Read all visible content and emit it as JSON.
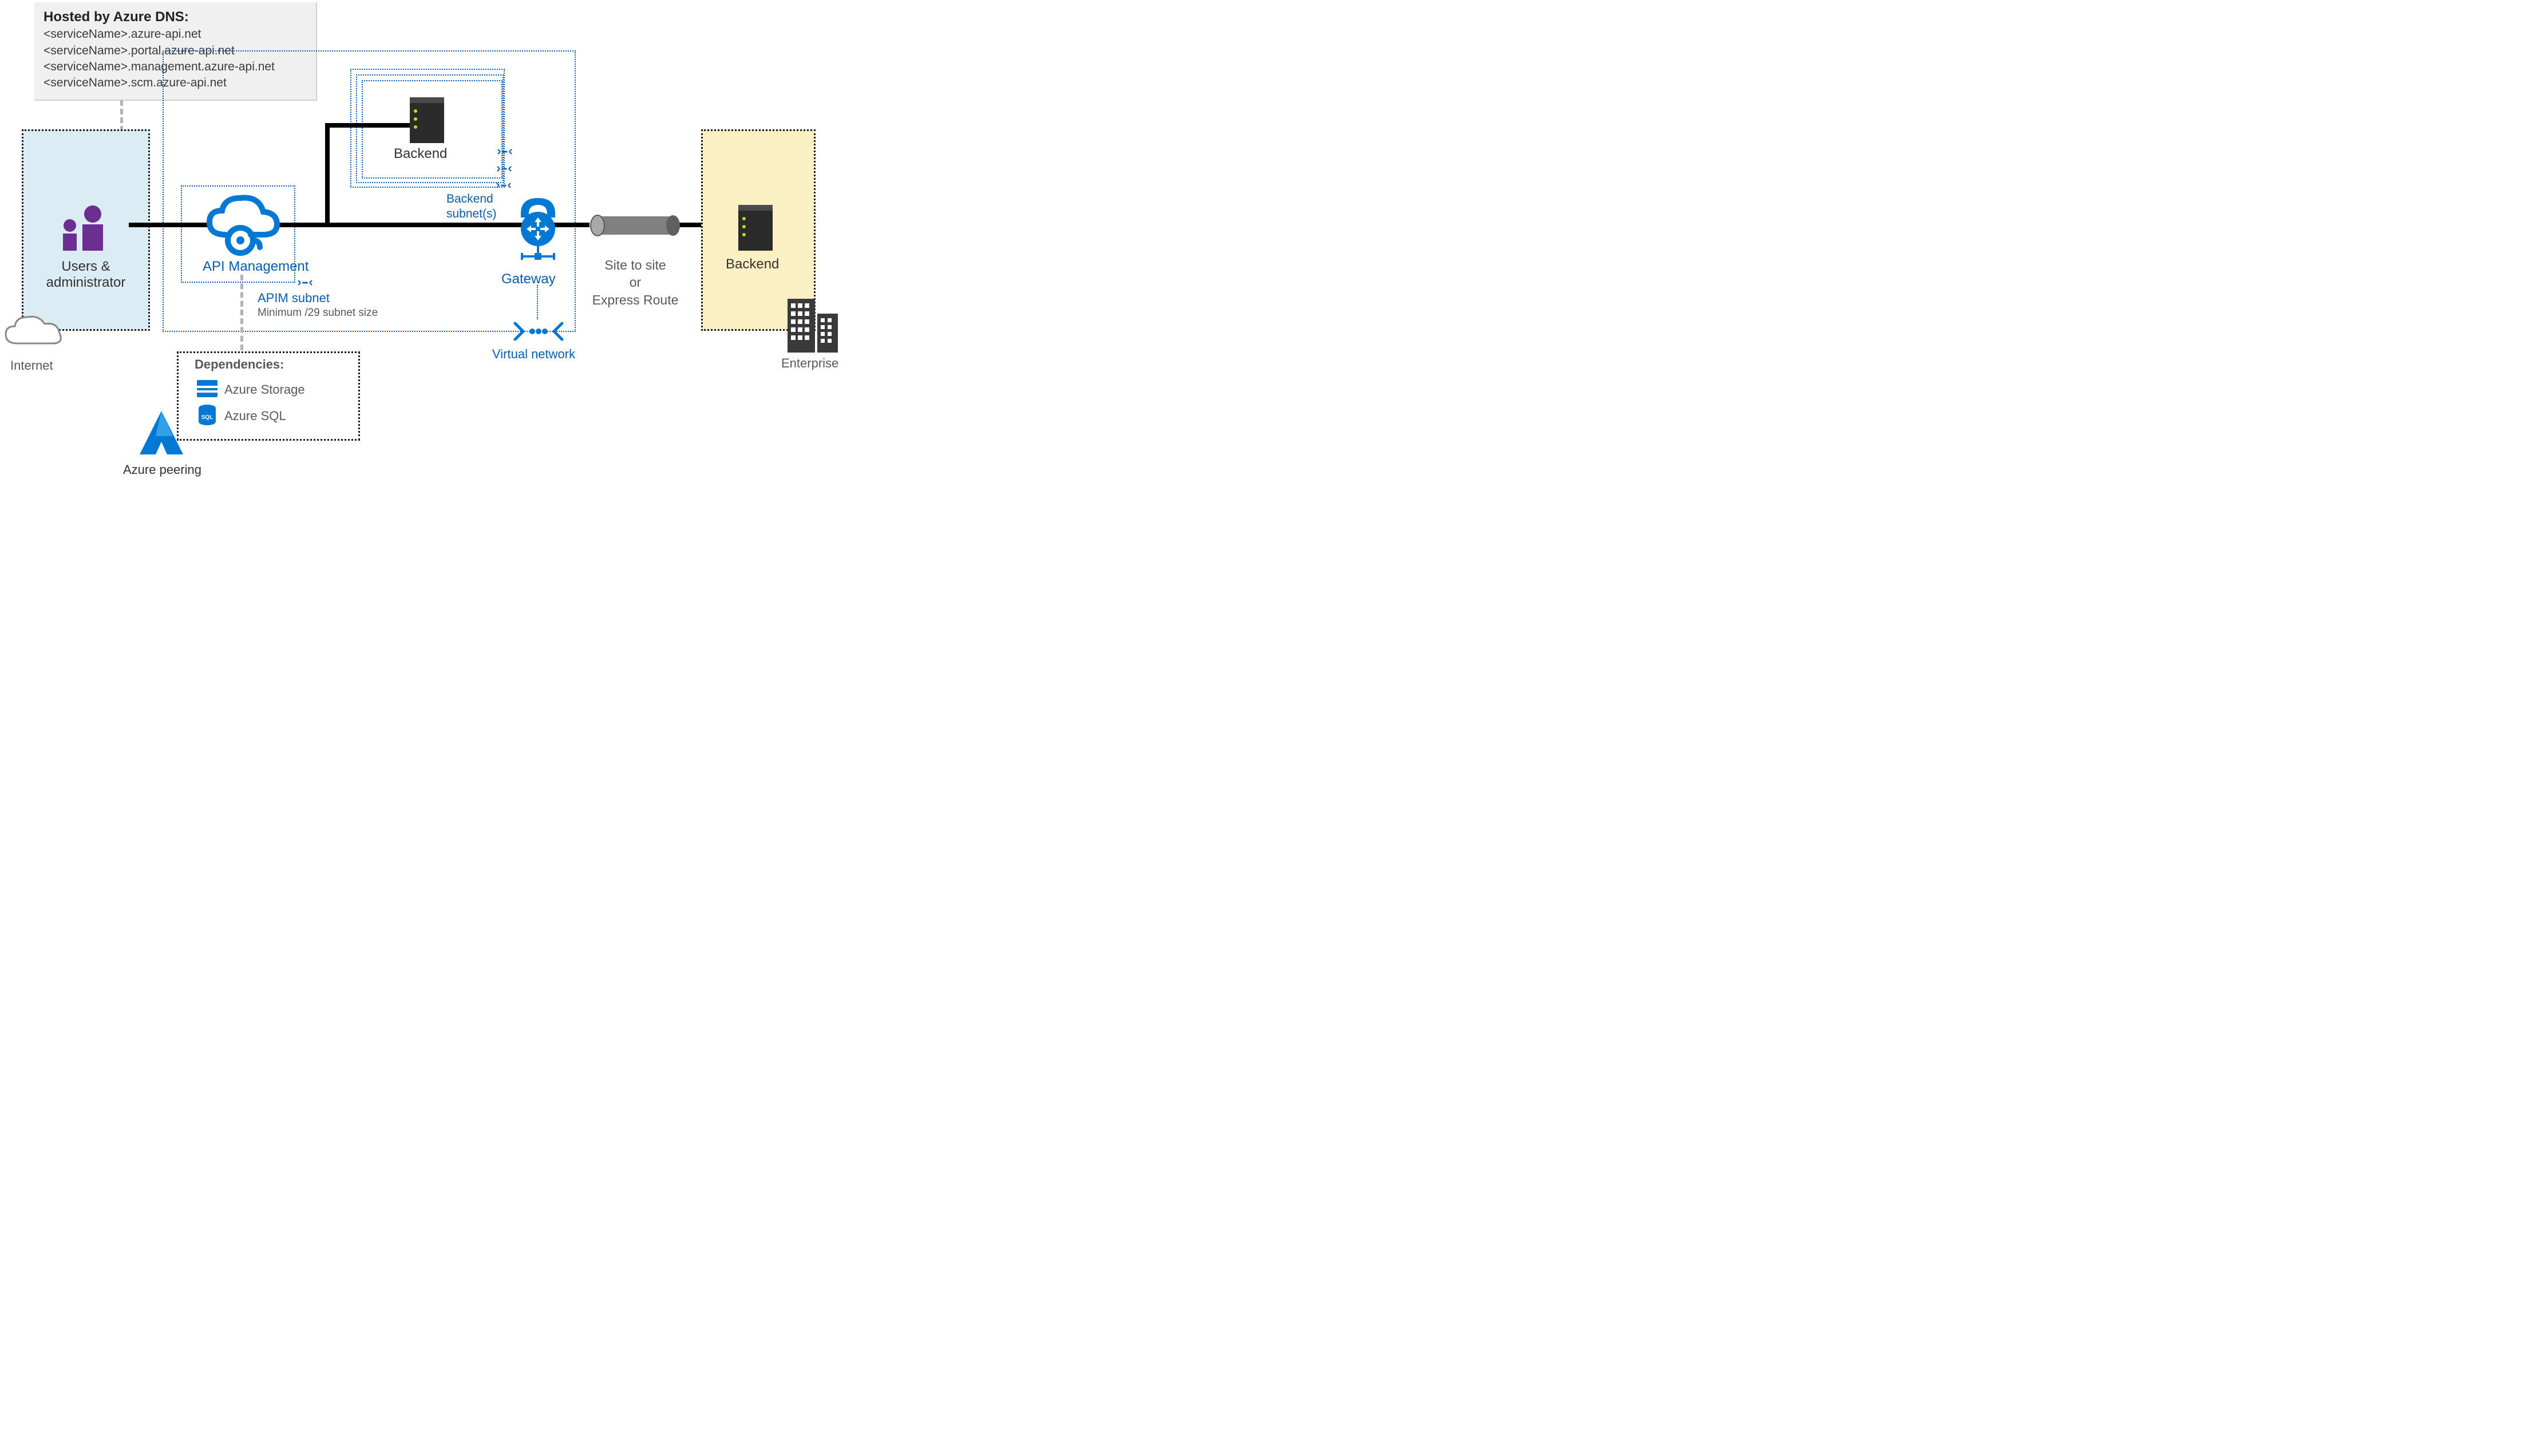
{
  "dns": {
    "title": "Hosted by Azure DNS:",
    "lines": [
      "<serviceName>.azure-api.net",
      "<serviceName>.portal.azure-api.net",
      "<serviceName>.management.azure-api.net",
      "<serviceName>.scm.azure-api.net"
    ]
  },
  "internet": {
    "label": "Internet"
  },
  "users": {
    "label_line1": "Users &",
    "label_line2": "administrator"
  },
  "apim": {
    "label": "API Management",
    "subnet_label": "APIM subnet",
    "subnet_note": "Minimum /29 subnet size"
  },
  "backend_center": {
    "label": "Backend"
  },
  "backend_subnets": {
    "label": "Backend subnet(s)"
  },
  "gateway": {
    "label": "Gateway"
  },
  "site_to_site": {
    "line1": "Site to site",
    "line2": "or",
    "line3": "Express Route"
  },
  "enterprise": {
    "backend_label": "Backend",
    "label": "Enterprise"
  },
  "vnet": {
    "label": "Virtual network"
  },
  "dependencies": {
    "title": "Dependencies:",
    "items": [
      "Azure Storage",
      "Azure SQL"
    ]
  },
  "azure_peering": {
    "label": "Azure peering"
  },
  "colors": {
    "azure_blue": "#0b5cad",
    "brand_blue": "#0078d4",
    "purple": "#6b2e91",
    "panel_blue": "#dbecf4",
    "panel_yellow": "#fbf0c3",
    "grey": "#808080"
  }
}
